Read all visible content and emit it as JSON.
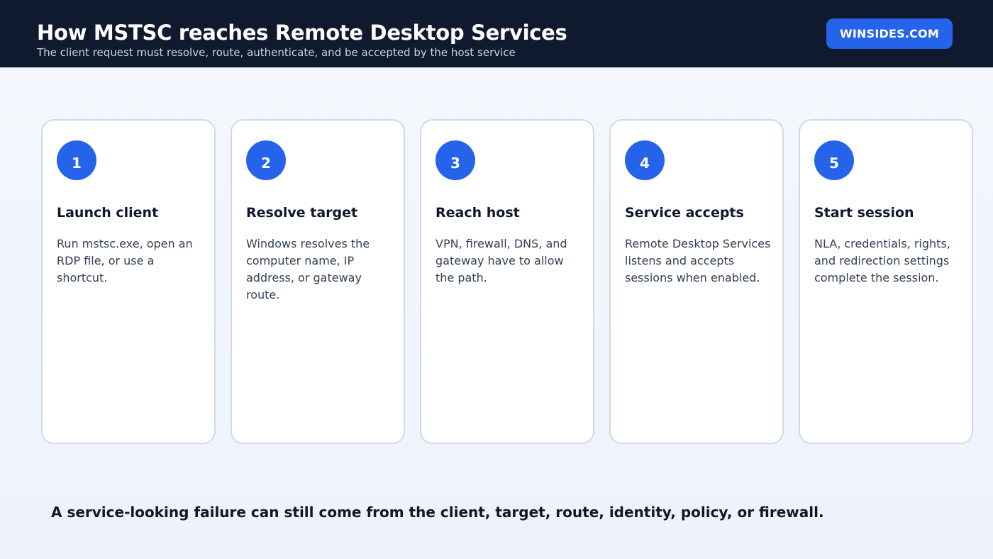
{
  "header": {
    "title": "How MSTSC reaches Remote Desktop Services",
    "subtitle": "The client request must resolve, route, authenticate, and be accepted by the host service",
    "brand": "WINSIDES.COM"
  },
  "steps": [
    {
      "number": "1",
      "title": "Launch client",
      "text": "Run mstsc.exe, open an RDP file, or use a shortcut."
    },
    {
      "number": "2",
      "title": "Resolve target",
      "text": "Windows resolves the computer name, IP address, or gateway route."
    },
    {
      "number": "3",
      "title": "Reach host",
      "text": "VPN, firewall, DNS, and gateway have to allow the path."
    },
    {
      "number": "4",
      "title": "Service accepts",
      "text": "Remote Desktop Services listens and accepts sessions when enabled."
    },
    {
      "number": "5",
      "title": "Start session",
      "text": "NLA, credentials, rights, and redirection settings complete the session."
    }
  ],
  "footer": {
    "note": "A service-looking failure can still come from the client, target, route, identity, policy, or firewall."
  },
  "colors": {
    "header_bg": "#0f1a2e",
    "accent": "#2563eb",
    "card_border": "#d1d9e6"
  }
}
